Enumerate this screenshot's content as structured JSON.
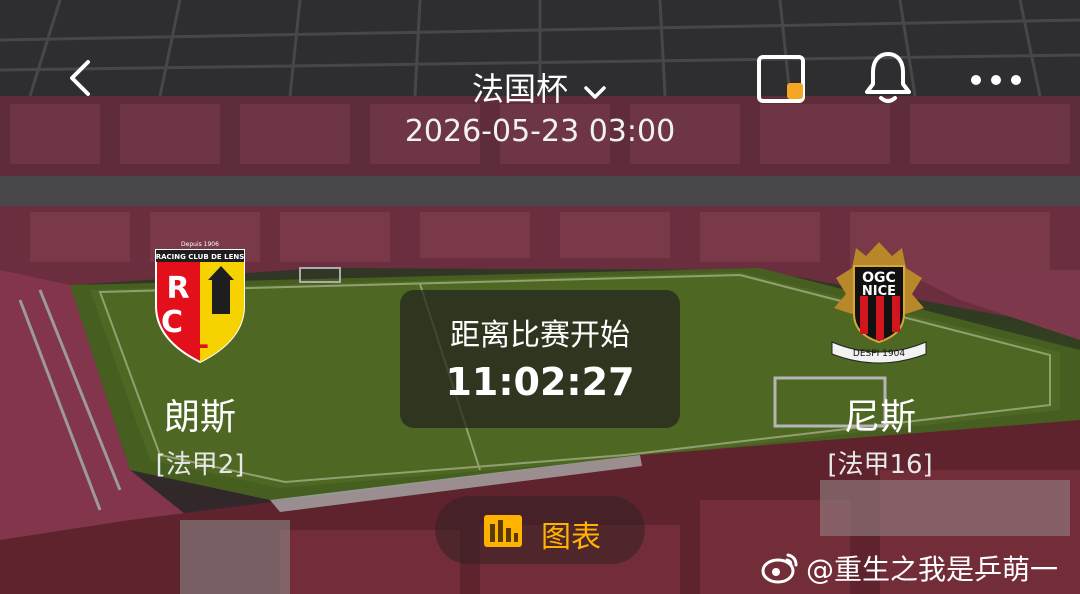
{
  "header": {
    "back_icon": "chevron-left-icon",
    "competition": "法国杯",
    "dropdown_icon": "chevron-down-icon",
    "datetime": "2026-05-23 03:00",
    "pip_icon": "picture-in-picture-icon",
    "bell_icon": "bell-icon",
    "more_icon": "more-horizontal-icon"
  },
  "match": {
    "home": {
      "name": "朗斯",
      "rank": "[法甲2]",
      "logo_text": "RCL",
      "logo_caption": "RACING CLUB DE LENS",
      "logo_small": "Depuis 1906"
    },
    "away": {
      "name": "尼斯",
      "rank": "[法甲16]",
      "logo_text_1": "OGC",
      "logo_text_2": "NICE",
      "logo_caption": "DESPI 1904"
    },
    "countdown_label": "距离比赛开始",
    "countdown": "11:02:27"
  },
  "chart_button": {
    "label": "图表",
    "icon": "bar-chart-icon"
  },
  "watermark": {
    "text": "@重生之我是乒萌一",
    "icon": "weibo-icon"
  },
  "colors": {
    "accent": "#ffb300",
    "pip_dot": "#f5a623"
  }
}
